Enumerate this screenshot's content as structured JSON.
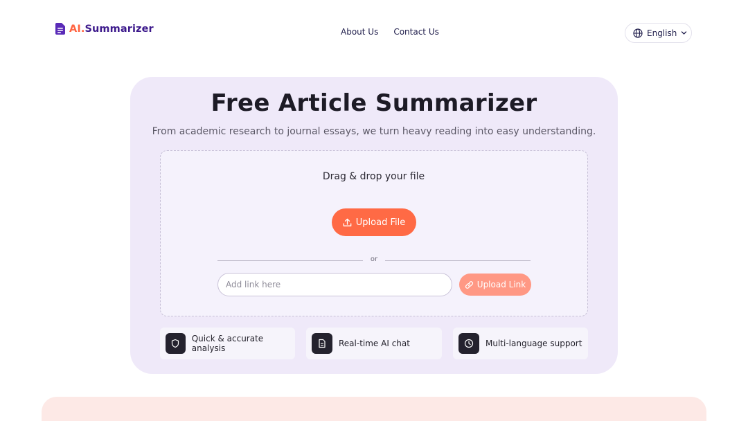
{
  "brand": {
    "ai": "AI.",
    "name": "Summarizer",
    "icon": "document-icon",
    "accent": "#ff6340",
    "brand_color": "#3d1a8c"
  },
  "nav": {
    "about": "About Us",
    "contact": "Contact Us"
  },
  "language": {
    "label": "English",
    "icon": "globe-icon"
  },
  "hero": {
    "title": "Free Article Summarizer",
    "subtitle": "From academic research to journal essays, we turn heavy reading into easy understanding."
  },
  "dropzone": {
    "label": "Drag & drop your file",
    "upload_button": "Upload File",
    "or": "or",
    "link_placeholder": "Add link here",
    "link_button": "Upload Link"
  },
  "features": [
    {
      "label": "Quick & accurate analysis",
      "icon": "shield-icon"
    },
    {
      "label": "Real-time AI chat",
      "icon": "document-icon"
    },
    {
      "label": "Multi-language support",
      "icon": "clock-icon"
    }
  ],
  "colors": {
    "primary_button": "#ff6a45",
    "secondary_button": "#ff9884",
    "hero_bg": "#efe9f9"
  }
}
